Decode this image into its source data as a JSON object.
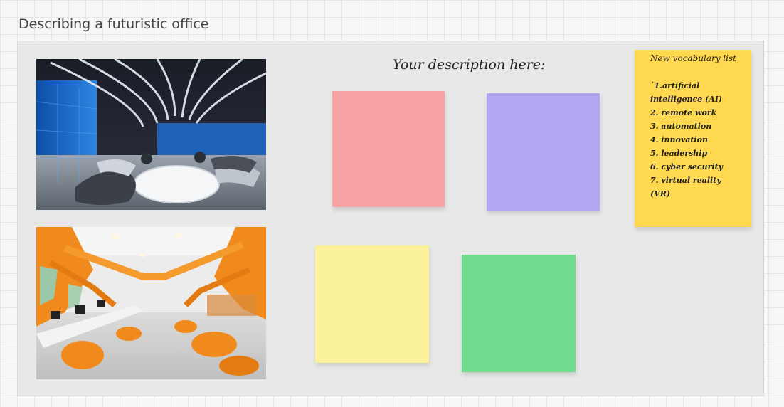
{
  "frame": {
    "title": "Describing a futuristic office"
  },
  "board": {
    "heading": "Your description here:",
    "colors": {
      "canvas": "#f7f7f7",
      "frame": "#e8e8e8"
    },
    "sticky_notes": [
      {
        "name": "red",
        "color": "#f7a3a3",
        "text": ""
      },
      {
        "name": "purple",
        "color": "#b3a5f0",
        "text": ""
      },
      {
        "name": "yellow",
        "color": "#fcf29a",
        "text": ""
      },
      {
        "name": "green",
        "color": "#6fdc8d",
        "text": ""
      }
    ],
    "vocab_note": {
      "color": "#fed84e",
      "title": "New vocabulary list",
      "items": [
        "˙1.artificial\nintelligence (AI)",
        "2. remote work",
        "3. automation",
        "4. innovation",
        "5. leadership",
        "6. cyber security",
        "7. virtual reality (VR)"
      ]
    },
    "images": [
      {
        "name": "futuristic-office-blue-photo"
      },
      {
        "name": "futuristic-office-orange-photo"
      }
    ]
  }
}
